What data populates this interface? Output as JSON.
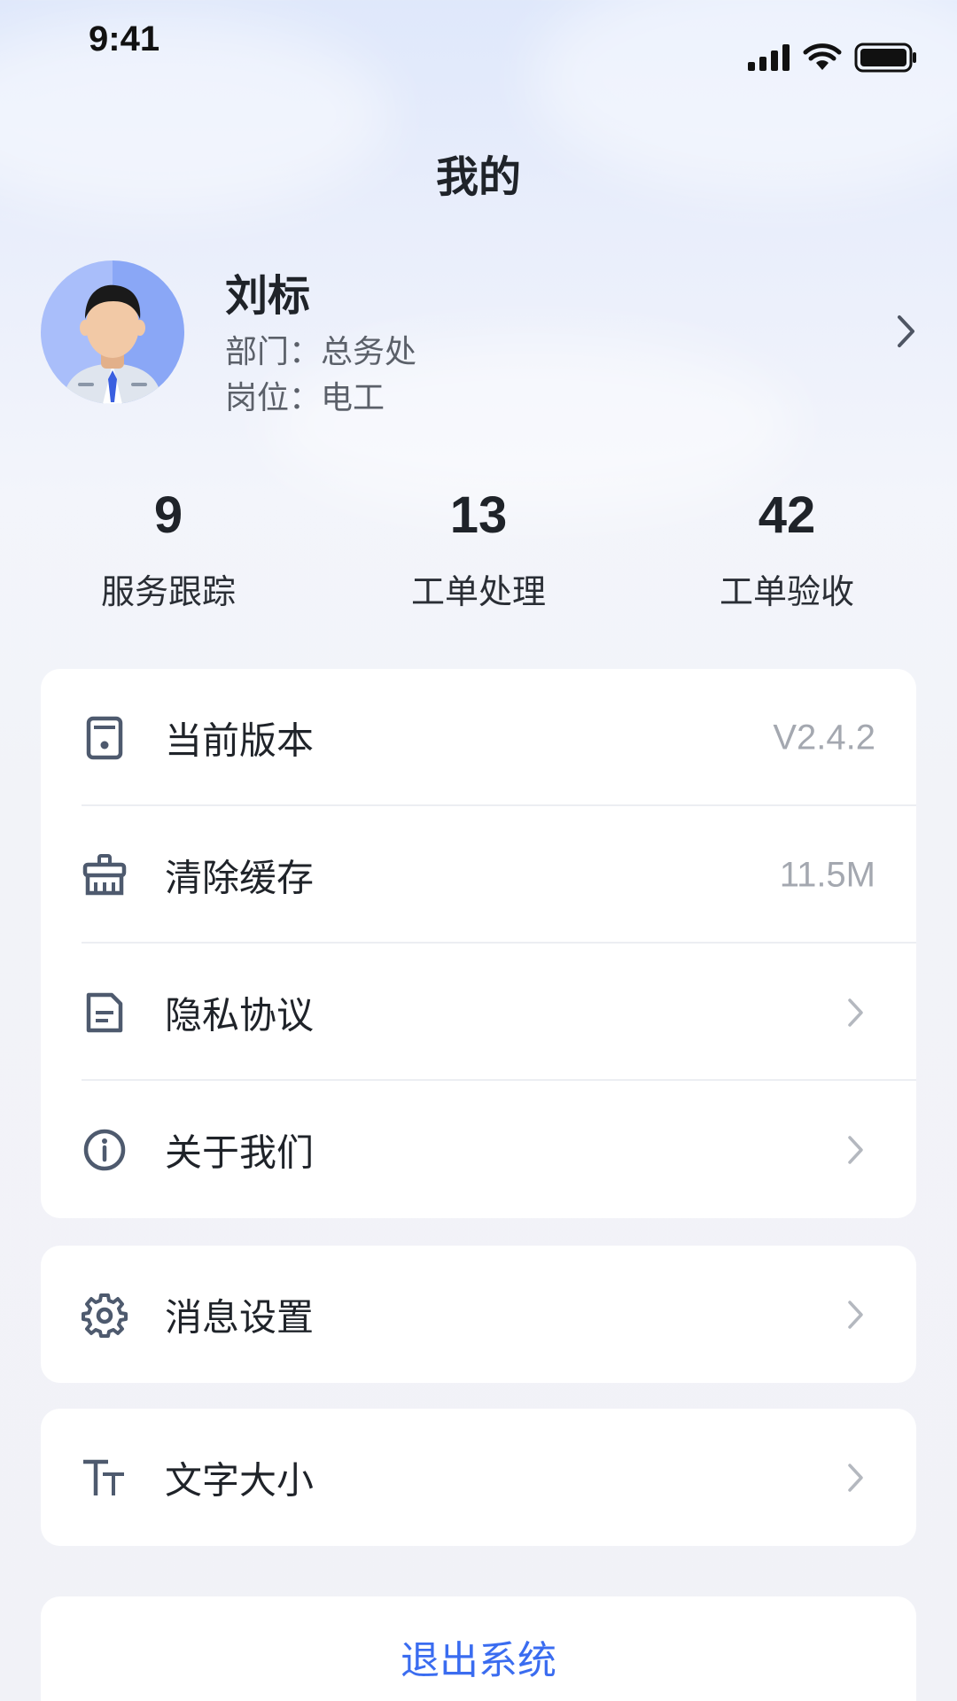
{
  "status_bar": {
    "time": "9:41"
  },
  "page": {
    "title": "我的"
  },
  "profile": {
    "name": "刘标",
    "department": "部门：总务处",
    "position": "岗位：电工"
  },
  "stats": [
    {
      "value": "9",
      "label": "服务跟踪"
    },
    {
      "value": "13",
      "label": "工单处理"
    },
    {
      "value": "42",
      "label": "工单验收"
    }
  ],
  "menu": {
    "version": {
      "label": "当前版本",
      "value": "V2.4.2",
      "icon": "phone-icon"
    },
    "cache": {
      "label": "清除缓存",
      "value": "11.5M",
      "icon": "broom-icon"
    },
    "privacy": {
      "label": "隐私协议",
      "icon": "document-icon"
    },
    "about": {
      "label": "关于我们",
      "icon": "info-icon"
    },
    "notifications": {
      "label": "消息设置",
      "icon": "gear-icon"
    },
    "font_size": {
      "label": "文字大小",
      "icon": "text-size-icon"
    }
  },
  "logout": {
    "label": "退出系统"
  },
  "colors": {
    "accent": "#3a6cf0",
    "icon": "#4e5a6e"
  }
}
